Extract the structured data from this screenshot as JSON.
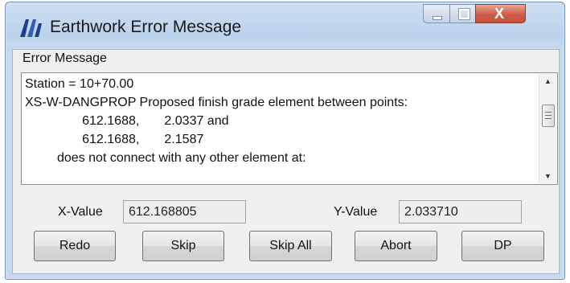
{
  "window": {
    "title": "Earthwork Error Message"
  },
  "titlebar": {
    "close_glyph": "X"
  },
  "panel": {
    "caption": "Error Message"
  },
  "message_lines": [
    "Station = 10+70.00",
    "XS-W-DANGPROP Proposed finish grade element between points:",
    "                612.1688,       2.0337 and",
    "                612.1688,       2.1587",
    "         does not connect with any other element at:"
  ],
  "fields": {
    "x_label": "X-Value",
    "x_value": "612.168805",
    "y_label": "Y-Value",
    "y_value": "2.033710"
  },
  "buttons": {
    "redo": "Redo",
    "skip": "Skip",
    "skip_all": "Skip All",
    "abort": "Abort",
    "dp": "DP"
  },
  "colors": {
    "titlebar": "#bcd2ec",
    "close_button": "#cd5d48",
    "app_icon": "#1f3e8c"
  },
  "icons": {
    "app": "earthwork-app-icon",
    "min": "minimize-icon",
    "max": "maximize-icon",
    "close": "close-icon"
  }
}
